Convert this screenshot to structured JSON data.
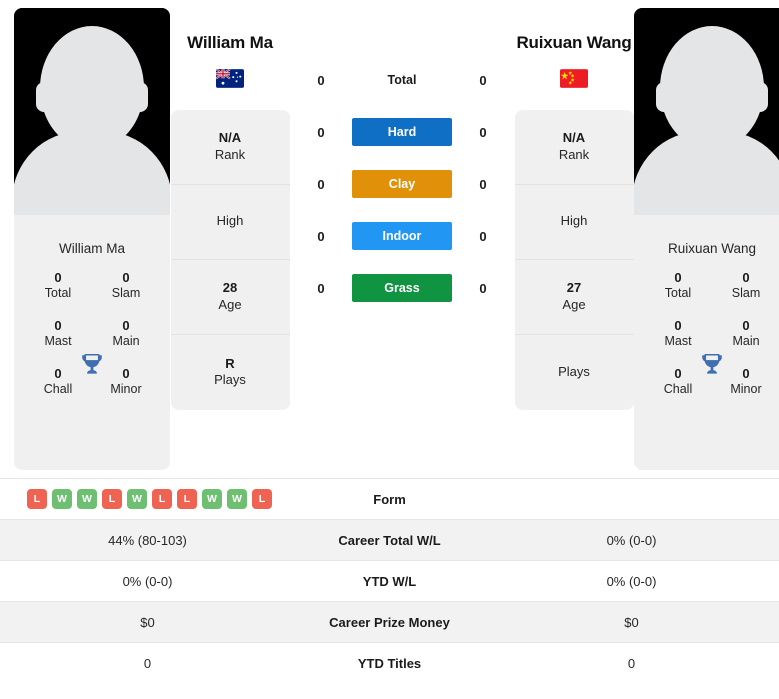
{
  "players": {
    "left": {
      "name": "William Ma",
      "photo_caption": "William Ma",
      "flag": "australia-flag",
      "flag_country": "Australia",
      "titles": [
        {
          "value": "0",
          "label": "Total"
        },
        {
          "value": "0",
          "label": "Slam"
        },
        {
          "value": "0",
          "label": "Mast"
        },
        {
          "value": "0",
          "label": "Main"
        },
        {
          "value": "0",
          "label": "Chall"
        },
        {
          "value": "0",
          "label": "Minor"
        }
      ],
      "info": [
        {
          "value": "N/A",
          "label": "Rank"
        },
        {
          "value": "",
          "label": "High"
        },
        {
          "value": "28",
          "label": "Age"
        },
        {
          "value": "R",
          "label": "Plays"
        }
      ]
    },
    "right": {
      "name": "Ruixuan Wang",
      "photo_caption": "Ruixuan Wang",
      "flag": "china-flag",
      "flag_country": "China",
      "titles": [
        {
          "value": "0",
          "label": "Total"
        },
        {
          "value": "0",
          "label": "Slam"
        },
        {
          "value": "0",
          "label": "Mast"
        },
        {
          "value": "0",
          "label": "Main"
        },
        {
          "value": "0",
          "label": "Chall"
        },
        {
          "value": "0",
          "label": "Minor"
        }
      ],
      "info": [
        {
          "value": "N/A",
          "label": "Rank"
        },
        {
          "value": "",
          "label": "High"
        },
        {
          "value": "27",
          "label": "Age"
        },
        {
          "value": "",
          "label": "Plays"
        }
      ]
    }
  },
  "surfaces": [
    {
      "label": "Total",
      "left": "0",
      "right": "0",
      "color": "transparent",
      "text_color": "#1b1b1b"
    },
    {
      "label": "Hard",
      "left": "0",
      "right": "0",
      "color": "#0f6fc5",
      "text_color": "#ffffff"
    },
    {
      "label": "Clay",
      "left": "0",
      "right": "0",
      "color": "#e09009",
      "text_color": "#ffffff"
    },
    {
      "label": "Indoor",
      "left": "0",
      "right": "0",
      "color": "#2196f3",
      "text_color": "#ffffff"
    },
    {
      "label": "Grass",
      "left": "0",
      "right": "0",
      "color": "#109442",
      "text_color": "#ffffff"
    }
  ],
  "comparison_rows": [
    {
      "label": "Form",
      "left_form": [
        "L",
        "W",
        "W",
        "L",
        "W",
        "L",
        "L",
        "W",
        "W",
        "L"
      ],
      "right": "",
      "shaded": false
    },
    {
      "label": "Career Total W/L",
      "left": "44% (80-103)",
      "right": "0% (0-0)",
      "shaded": true
    },
    {
      "label": "YTD W/L",
      "left": "0% (0-0)",
      "right": "0% (0-0)",
      "shaded": false
    },
    {
      "label": "Career Prize Money",
      "left": "$0",
      "right": "$0",
      "shaded": true
    },
    {
      "label": "YTD Titles",
      "left": "0",
      "right": "0",
      "shaded": false
    }
  ],
  "colors": {
    "win_badge": "#6fbf73",
    "loss_badge": "#ee6352",
    "trophy": "#3f6fb0",
    "card_bg": "#f0f0f0",
    "row_shade": "#f2f2f2"
  }
}
